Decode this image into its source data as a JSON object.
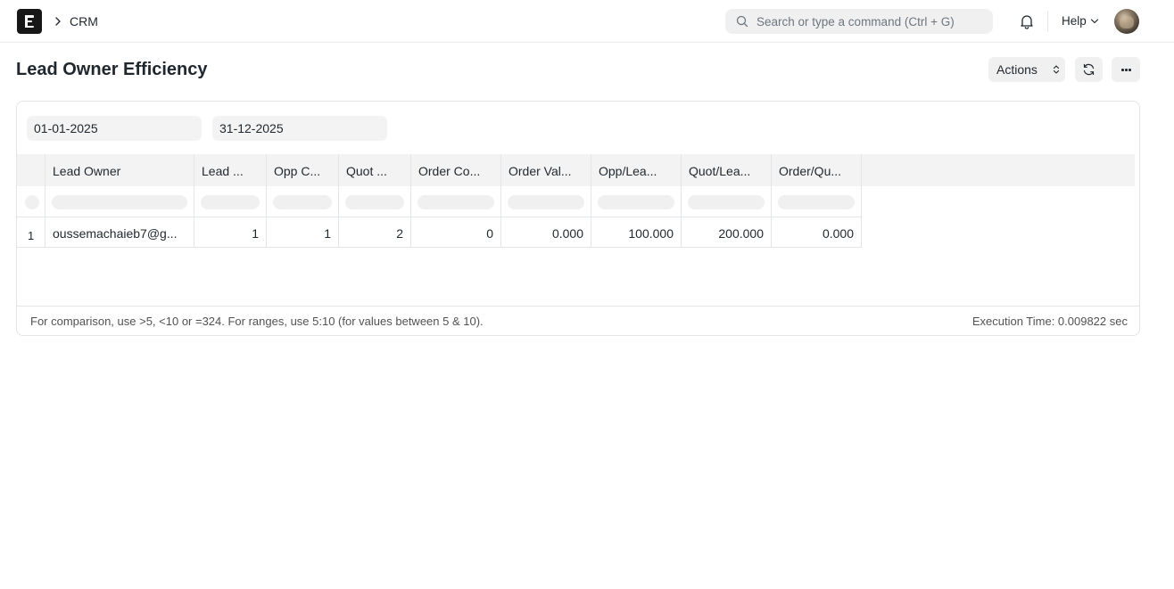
{
  "navbar": {
    "logo_letter": "E",
    "breadcrumb": "CRM",
    "search_placeholder": "Search or type a command (Ctrl + G)",
    "help_label": "Help"
  },
  "page": {
    "title": "Lead Owner Efficiency",
    "actions_label": "Actions"
  },
  "filters": {
    "from_date": "01-01-2025",
    "to_date": "31-12-2025"
  },
  "table": {
    "columns": [
      "Lead Owner",
      "Lead ...",
      "Opp C...",
      "Quot ...",
      "Order Co...",
      "Order Val...",
      "Opp/Lea...",
      "Quot/Lea...",
      "Order/Qu..."
    ],
    "rows": [
      {
        "index": "1",
        "cells": [
          "oussemachaieb7@g...",
          "1",
          "1",
          "2",
          "0",
          "0.000",
          "100.000",
          "200.000",
          "0.000"
        ]
      }
    ]
  },
  "footer": {
    "help_text": "For comparison, use >5, <10 or =324. For ranges, use 5:10 (for values between 5 & 10).",
    "execution_time": "Execution Time: 0.009822 sec"
  }
}
